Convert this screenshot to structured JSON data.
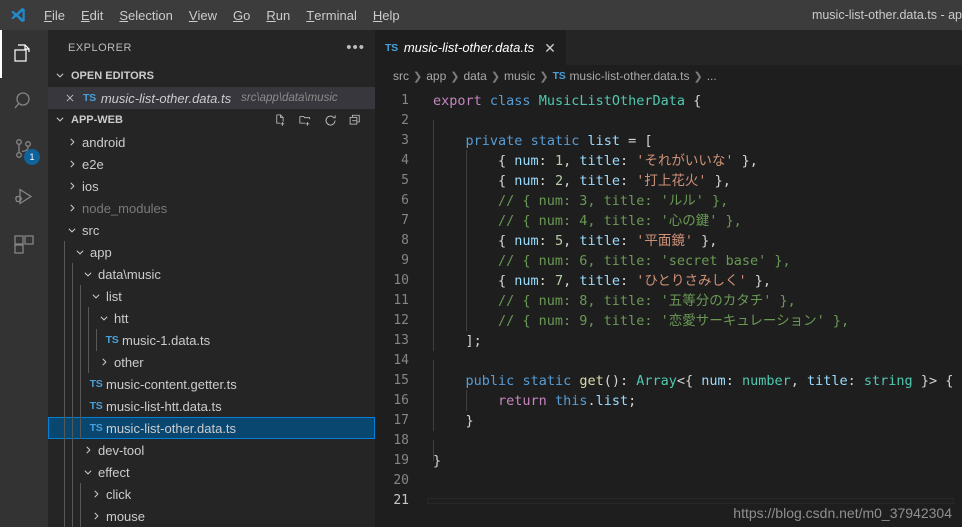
{
  "window": {
    "title": "music-list-other.data.ts - ap",
    "logo_icon": "vscode-logo"
  },
  "menubar": {
    "items": [
      {
        "label": "File",
        "mnemonic": "F",
        "rest": "ile"
      },
      {
        "label": "Edit",
        "mnemonic": "E",
        "rest": "dit"
      },
      {
        "label": "Selection",
        "mnemonic": "S",
        "rest": "election"
      },
      {
        "label": "View",
        "mnemonic": "V",
        "rest": "iew"
      },
      {
        "label": "Go",
        "mnemonic": "G",
        "rest": "o"
      },
      {
        "label": "Run",
        "mnemonic": "R",
        "rest": "un"
      },
      {
        "label": "Terminal",
        "mnemonic": "T",
        "rest": "erminal"
      },
      {
        "label": "Help",
        "mnemonic": "H",
        "rest": "elp"
      }
    ]
  },
  "activitybar": {
    "items": [
      {
        "name": "explorer-icon",
        "label": "Explorer",
        "active": true,
        "badge": ""
      },
      {
        "name": "search-icon",
        "label": "Search",
        "active": false,
        "badge": ""
      },
      {
        "name": "source-control-icon",
        "label": "Source Control",
        "active": false,
        "badge": "1"
      },
      {
        "name": "run-debug-icon",
        "label": "Run and Debug",
        "active": false,
        "badge": ""
      },
      {
        "name": "extensions-icon",
        "label": "Extensions",
        "active": false,
        "badge": ""
      }
    ]
  },
  "sidebar": {
    "title": "EXPLORER",
    "more_actions": "•••",
    "open_editors": {
      "label": "OPEN EDITORS",
      "items": [
        {
          "name": "music-list-other.data.ts",
          "path": "src\\app\\data\\music",
          "badge": "TS"
        }
      ]
    },
    "workspace": {
      "label": "APP-WEB",
      "actions": [
        "new-file-icon",
        "new-folder-icon",
        "refresh-icon",
        "collapse-all-icon"
      ],
      "tree": [
        {
          "label": "android",
          "depth": 1,
          "kind": "folder",
          "open": false,
          "dim": false,
          "selected": false
        },
        {
          "label": "e2e",
          "depth": 1,
          "kind": "folder",
          "open": false,
          "dim": false,
          "selected": false
        },
        {
          "label": "ios",
          "depth": 1,
          "kind": "folder",
          "open": false,
          "dim": false,
          "selected": false
        },
        {
          "label": "node_modules",
          "depth": 1,
          "kind": "folder",
          "open": false,
          "dim": true,
          "selected": false
        },
        {
          "label": "src",
          "depth": 1,
          "kind": "folder",
          "open": true,
          "dim": false,
          "selected": false
        },
        {
          "label": "app",
          "depth": 2,
          "kind": "folder",
          "open": true,
          "dim": false,
          "selected": false
        },
        {
          "label": "data\\music",
          "depth": 3,
          "kind": "folder",
          "open": true,
          "dim": false,
          "selected": false
        },
        {
          "label": "list",
          "depth": 4,
          "kind": "folder",
          "open": true,
          "dim": false,
          "selected": false
        },
        {
          "label": "htt",
          "depth": 5,
          "kind": "folder",
          "open": true,
          "dim": false,
          "selected": false
        },
        {
          "label": "music-1.data.ts",
          "depth": 6,
          "kind": "file",
          "open": false,
          "dim": false,
          "selected": false,
          "badge": "TS"
        },
        {
          "label": "other",
          "depth": 5,
          "kind": "folder",
          "open": false,
          "dim": false,
          "selected": false
        },
        {
          "label": "music-content.getter.ts",
          "depth": 4,
          "kind": "file",
          "open": false,
          "dim": false,
          "selected": false,
          "badge": "TS"
        },
        {
          "label": "music-list-htt.data.ts",
          "depth": 4,
          "kind": "file",
          "open": false,
          "dim": false,
          "selected": false,
          "badge": "TS"
        },
        {
          "label": "music-list-other.data.ts",
          "depth": 4,
          "kind": "file",
          "open": false,
          "dim": false,
          "selected": true,
          "badge": "TS"
        },
        {
          "label": "dev-tool",
          "depth": 3,
          "kind": "folder",
          "open": false,
          "dim": false,
          "selected": false
        },
        {
          "label": "effect",
          "depth": 3,
          "kind": "folder",
          "open": true,
          "dim": false,
          "selected": false
        },
        {
          "label": "click",
          "depth": 4,
          "kind": "folder",
          "open": false,
          "dim": false,
          "selected": false
        },
        {
          "label": "mouse",
          "depth": 4,
          "kind": "folder",
          "open": false,
          "dim": false,
          "selected": false
        }
      ]
    }
  },
  "editor": {
    "tab": {
      "badge": "TS",
      "title": "music-list-other.data.ts",
      "close": "✕",
      "preview": true
    },
    "breadcrumbs": [
      {
        "label": "src",
        "badge": ""
      },
      {
        "label": "app",
        "badge": ""
      },
      {
        "label": "data",
        "badge": ""
      },
      {
        "label": "music",
        "badge": ""
      },
      {
        "label": "music-list-other.data.ts",
        "badge": "TS"
      },
      {
        "label": "...",
        "badge": ""
      }
    ],
    "current_line": 21,
    "lines": [
      {
        "n": 1,
        "guides": 0,
        "tokens": [
          {
            "t": "export",
            "c": "k-purple"
          },
          {
            "t": " ",
            "c": "k-plain"
          },
          {
            "t": "class",
            "c": "k-blue"
          },
          {
            "t": " ",
            "c": "k-plain"
          },
          {
            "t": "MusicListOtherData",
            "c": "k-type"
          },
          {
            "t": " {",
            "c": "k-plain"
          }
        ]
      },
      {
        "n": 2,
        "guides": 1,
        "tokens": []
      },
      {
        "n": 3,
        "guides": 1,
        "tokens": [
          {
            "t": "    ",
            "c": "k-plain"
          },
          {
            "t": "private",
            "c": "k-blue"
          },
          {
            "t": " ",
            "c": "k-plain"
          },
          {
            "t": "static",
            "c": "k-blue"
          },
          {
            "t": " ",
            "c": "k-plain"
          },
          {
            "t": "list",
            "c": "k-var"
          },
          {
            "t": " = [",
            "c": "k-plain"
          }
        ]
      },
      {
        "n": 4,
        "guides": 2,
        "tokens": [
          {
            "t": "        { ",
            "c": "k-plain"
          },
          {
            "t": "num",
            "c": "k-var"
          },
          {
            "t": ": ",
            "c": "k-plain"
          },
          {
            "t": "1",
            "c": "k-num"
          },
          {
            "t": ", ",
            "c": "k-plain"
          },
          {
            "t": "title",
            "c": "k-var"
          },
          {
            "t": ": ",
            "c": "k-plain"
          },
          {
            "t": "'それがいいな'",
            "c": "k-str"
          },
          {
            "t": " },",
            "c": "k-plain"
          }
        ]
      },
      {
        "n": 5,
        "guides": 2,
        "tokens": [
          {
            "t": "        { ",
            "c": "k-plain"
          },
          {
            "t": "num",
            "c": "k-var"
          },
          {
            "t": ": ",
            "c": "k-plain"
          },
          {
            "t": "2",
            "c": "k-num"
          },
          {
            "t": ", ",
            "c": "k-plain"
          },
          {
            "t": "title",
            "c": "k-var"
          },
          {
            "t": ": ",
            "c": "k-plain"
          },
          {
            "t": "'打上花火'",
            "c": "k-str"
          },
          {
            "t": " },",
            "c": "k-plain"
          }
        ]
      },
      {
        "n": 6,
        "guides": 2,
        "tokens": [
          {
            "t": "        // { num: 3, title: 'ルル' },",
            "c": "k-cmt"
          }
        ]
      },
      {
        "n": 7,
        "guides": 2,
        "tokens": [
          {
            "t": "        // { num: 4, title: '心の鍵' },",
            "c": "k-cmt"
          }
        ]
      },
      {
        "n": 8,
        "guides": 2,
        "tokens": [
          {
            "t": "        { ",
            "c": "k-plain"
          },
          {
            "t": "num",
            "c": "k-var"
          },
          {
            "t": ": ",
            "c": "k-plain"
          },
          {
            "t": "5",
            "c": "k-num"
          },
          {
            "t": ", ",
            "c": "k-plain"
          },
          {
            "t": "title",
            "c": "k-var"
          },
          {
            "t": ": ",
            "c": "k-plain"
          },
          {
            "t": "'平面鏡'",
            "c": "k-str"
          },
          {
            "t": " },",
            "c": "k-plain"
          }
        ]
      },
      {
        "n": 9,
        "guides": 2,
        "tokens": [
          {
            "t": "        // { num: 6, title: 'secret base' },",
            "c": "k-cmt"
          }
        ]
      },
      {
        "n": 10,
        "guides": 2,
        "tokens": [
          {
            "t": "        { ",
            "c": "k-plain"
          },
          {
            "t": "num",
            "c": "k-var"
          },
          {
            "t": ": ",
            "c": "k-plain"
          },
          {
            "t": "7",
            "c": "k-num"
          },
          {
            "t": ", ",
            "c": "k-plain"
          },
          {
            "t": "title",
            "c": "k-var"
          },
          {
            "t": ": ",
            "c": "k-plain"
          },
          {
            "t": "'ひとりさみしく'",
            "c": "k-str"
          },
          {
            "t": " },",
            "c": "k-plain"
          }
        ]
      },
      {
        "n": 11,
        "guides": 2,
        "tokens": [
          {
            "t": "        // { num: 8, title: '五等分のカタチ' },",
            "c": "k-cmt"
          }
        ]
      },
      {
        "n": 12,
        "guides": 2,
        "tokens": [
          {
            "t": "        // { num: 9, title: '恋愛サーキュレーション' },",
            "c": "k-cmt"
          }
        ]
      },
      {
        "n": 13,
        "guides": 1,
        "tokens": [
          {
            "t": "    ];",
            "c": "k-plain"
          }
        ]
      },
      {
        "n": 14,
        "guides": 1,
        "tokens": []
      },
      {
        "n": 15,
        "guides": 1,
        "tokens": [
          {
            "t": "    ",
            "c": "k-plain"
          },
          {
            "t": "public",
            "c": "k-blue"
          },
          {
            "t": " ",
            "c": "k-plain"
          },
          {
            "t": "static",
            "c": "k-blue"
          },
          {
            "t": " ",
            "c": "k-plain"
          },
          {
            "t": "get",
            "c": "k-func"
          },
          {
            "t": "(): ",
            "c": "k-plain"
          },
          {
            "t": "Array",
            "c": "k-type"
          },
          {
            "t": "<{ ",
            "c": "k-plain"
          },
          {
            "t": "num",
            "c": "k-var"
          },
          {
            "t": ": ",
            "c": "k-plain"
          },
          {
            "t": "number",
            "c": "k-type"
          },
          {
            "t": ", ",
            "c": "k-plain"
          },
          {
            "t": "title",
            "c": "k-var"
          },
          {
            "t": ": ",
            "c": "k-plain"
          },
          {
            "t": "string",
            "c": "k-type"
          },
          {
            "t": " }> {",
            "c": "k-plain"
          }
        ]
      },
      {
        "n": 16,
        "guides": 2,
        "tokens": [
          {
            "t": "        ",
            "c": "k-plain"
          },
          {
            "t": "return",
            "c": "k-purple"
          },
          {
            "t": " ",
            "c": "k-plain"
          },
          {
            "t": "this",
            "c": "k-blue"
          },
          {
            "t": ".",
            "c": "k-plain"
          },
          {
            "t": "list",
            "c": "k-var"
          },
          {
            "t": ";",
            "c": "k-plain"
          }
        ]
      },
      {
        "n": 17,
        "guides": 1,
        "tokens": [
          {
            "t": "    }",
            "c": "k-plain"
          }
        ]
      },
      {
        "n": 18,
        "guides": 1,
        "tokens": []
      },
      {
        "n": 19,
        "guides": 0,
        "tokens": [
          {
            "t": "}",
            "c": "k-plain"
          }
        ]
      },
      {
        "n": 20,
        "guides": 0,
        "tokens": []
      },
      {
        "n": 21,
        "guides": 0,
        "tokens": []
      }
    ]
  },
  "watermark": "https://blog.csdn.net/m0_37942304"
}
